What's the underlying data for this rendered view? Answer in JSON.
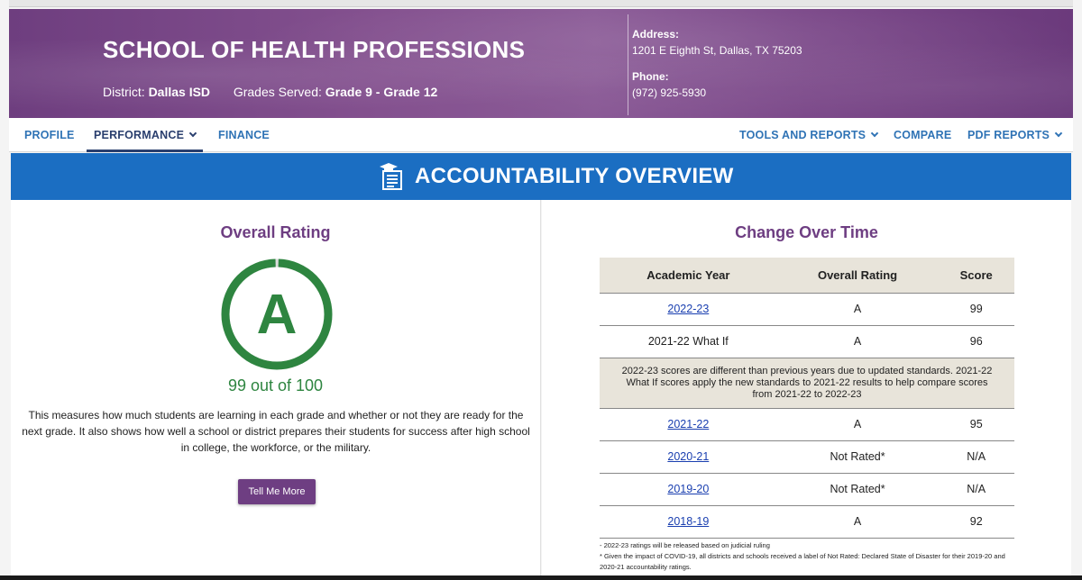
{
  "school": {
    "name": "SCHOOL OF HEALTH PROFESSIONS",
    "district_label": "District:",
    "district": "Dallas ISD",
    "grades_label": "Grades Served:",
    "grades": "Grade 9 - Grade 12",
    "address_label": "Address:",
    "address": "1201 E Eighth St, Dallas, TX 75203",
    "phone_label": "Phone:",
    "phone": "(972) 925-5930"
  },
  "nav": {
    "profile": "PROFILE",
    "performance": "PERFORMANCE",
    "finance": "FINANCE",
    "tools": "TOOLS AND REPORTS",
    "compare": "COMPARE",
    "pdf": "PDF REPORTS"
  },
  "section_title": "ACCOUNTABILITY OVERVIEW",
  "overall": {
    "heading": "Overall Rating",
    "grade": "A",
    "score_text": "99 out of 100",
    "score": 99,
    "max": 100,
    "description": "This measures how much students are learning in each grade and whether or not they are ready for the next grade. It also shows how well a school or district prepares their students for success after high school in college, the workforce, or the military.",
    "button": "Tell Me More"
  },
  "change": {
    "heading": "Change Over Time",
    "columns": [
      "Academic Year",
      "Overall Rating",
      "Score"
    ],
    "rows": [
      {
        "year": "2022-23",
        "rating": "A",
        "score": "99"
      },
      {
        "year": "2021-22 What If",
        "rating": "A",
        "score": "96"
      },
      {
        "year": "2021-22",
        "rating": "A",
        "score": "95"
      },
      {
        "year": "2020-21",
        "rating": "Not Rated*",
        "score": "N/A"
      },
      {
        "year": "2019-20",
        "rating": "Not Rated*",
        "score": "N/A"
      },
      {
        "year": "2018-19",
        "rating": "A",
        "score": "92"
      }
    ],
    "note": "2022-23 scores are different than previous years due to updated standards. 2021-22 What If scores apply the new standards to 2021-22 results to help compare scores from 2021-22 to 2022-23",
    "footnote1": "- 2022-23 ratings will be released based on judicial ruling",
    "footnote2": "* Given the impact of COVID-19, all districts and schools received a label of Not Rated: Declared State of Disaster for their 2019-20 and 2020-21 accountability ratings."
  },
  "colors": {
    "banner": "#7a4788",
    "accent_blue": "#1b6ec2",
    "grade_green": "#2e8540",
    "heading_purple": "#6e3e82"
  }
}
